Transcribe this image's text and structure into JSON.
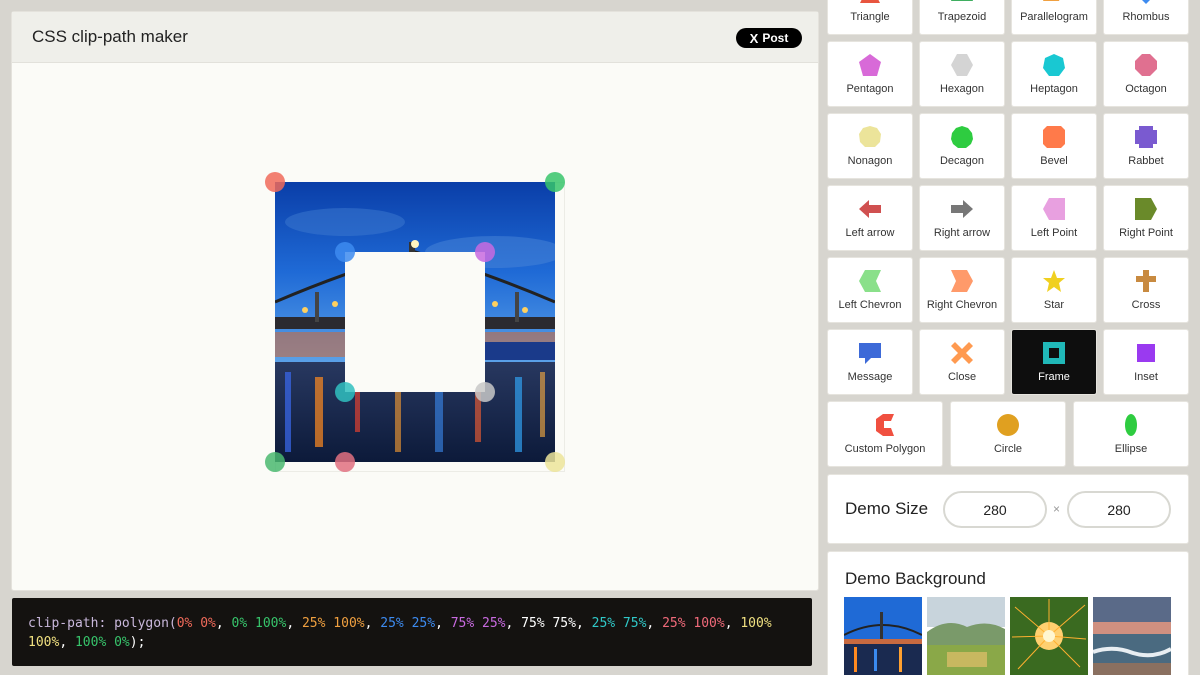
{
  "editor": {
    "title": "CSS clip-path maker",
    "post_label": "Post",
    "post_logo": "X"
  },
  "code": {
    "property": "clip-path:",
    "function": "polygon(",
    "points": [
      {
        "text": "0% 0%",
        "color": "#f06a5a"
      },
      {
        "text": "0% 100%",
        "color": "#37c46b"
      },
      {
        "text": "25% 100%",
        "color": "#f0a040"
      },
      {
        "text": "25% 25%",
        "color": "#3d8bf0"
      },
      {
        "text": "75% 25%",
        "color": "#c86ae0"
      },
      {
        "text": "75% 75%",
        "color": "#ffffff"
      },
      {
        "text": "25% 75%",
        "color": "#30c8c8"
      },
      {
        "text": "25% 100%",
        "color": "#f06a7a"
      },
      {
        "text": "100% 100%",
        "color": "#f0e080"
      },
      {
        "text": "100% 0%",
        "color": "#37c46b"
      }
    ],
    "separator": ", ",
    "closing": ");"
  },
  "handles": [
    {
      "name": "top-left",
      "color": "#f06a5a"
    },
    {
      "name": "top-right",
      "color": "#37c46b"
    },
    {
      "name": "inner-top-left",
      "color": "#3d8bf0"
    },
    {
      "name": "inner-top-right",
      "color": "#c86ae0"
    },
    {
      "name": "inner-bottom-left",
      "color": "#30c0c0"
    },
    {
      "name": "inner-bottom-right",
      "color": "#c8c8c8"
    },
    {
      "name": "bottom-left",
      "color": "#4ab870"
    },
    {
      "name": "bottom-mid",
      "color": "#e07080"
    },
    {
      "name": "bottom-right",
      "color": "#ece49a"
    }
  ],
  "shapes": [
    {
      "label": "Triangle",
      "color": "#e8553f",
      "icon": "triangle-icon"
    },
    {
      "label": "Trapezoid",
      "color": "#3fae60",
      "icon": "trapezoid-icon"
    },
    {
      "label": "Parallelogram",
      "color": "#f0a040",
      "icon": "parallelogram-icon"
    },
    {
      "label": "Rhombus",
      "color": "#3d8bf0",
      "icon": "rhombus-icon"
    },
    {
      "label": "Pentagon",
      "color": "#d86ad8",
      "icon": "pentagon-icon"
    },
    {
      "label": "Hexagon",
      "color": "#d4d4d4",
      "icon": "hexagon-icon"
    },
    {
      "label": "Heptagon",
      "color": "#19c8d2",
      "icon": "heptagon-icon"
    },
    {
      "label": "Octagon",
      "color": "#e07090",
      "icon": "octagon-icon"
    },
    {
      "label": "Nonagon",
      "color": "#ece49a",
      "icon": "nonagon-icon"
    },
    {
      "label": "Decagon",
      "color": "#2ecc40",
      "icon": "decagon-icon"
    },
    {
      "label": "Bevel",
      "color": "#ff7a4a",
      "icon": "bevel-icon"
    },
    {
      "label": "Rabbet",
      "color": "#7a5ad0",
      "icon": "rabbet-icon"
    },
    {
      "label": "Left arrow",
      "color": "#d05050",
      "icon": "left-arrow-icon"
    },
    {
      "label": "Right arrow",
      "color": "#777777",
      "icon": "right-arrow-icon"
    },
    {
      "label": "Left Point",
      "color": "#e8a0e0",
      "icon": "left-point-icon"
    },
    {
      "label": "Right Point",
      "color": "#6a8a2a",
      "icon": "right-point-icon"
    },
    {
      "label": "Left Chevron",
      "color": "#8ae08a",
      "icon": "left-chevron-icon"
    },
    {
      "label": "Right Chevron",
      "color": "#ff9a6a",
      "icon": "right-chevron-icon"
    },
    {
      "label": "Star",
      "color": "#f0d020",
      "icon": "star-icon"
    },
    {
      "label": "Cross",
      "color": "#c88a40",
      "icon": "cross-icon"
    },
    {
      "label": "Message",
      "color": "#3d6ad8",
      "icon": "message-icon"
    },
    {
      "label": "Close",
      "color": "#ff9a50",
      "icon": "close-shape-icon"
    },
    {
      "label": "Frame",
      "color": "#20b8b8",
      "icon": "frame-icon"
    },
    {
      "label": "Inset",
      "color": "#9a3af0",
      "icon": "inset-icon"
    },
    {
      "label": "Custom Polygon",
      "color": "#f05040",
      "icon": "custom-polygon-icon"
    },
    {
      "label": "Circle",
      "color": "#e0a020",
      "icon": "circle-icon"
    },
    {
      "label": "Ellipse",
      "color": "#2ecc40",
      "icon": "ellipse-icon"
    }
  ],
  "selected_shape": "Frame",
  "demo_size": {
    "label": "Demo Size",
    "width": "280",
    "height": "280",
    "times": "×"
  },
  "demo_background": {
    "label": "Demo Background",
    "thumbnails": [
      "bridge-night",
      "green-valley",
      "sparkler",
      "ocean-waves"
    ]
  }
}
